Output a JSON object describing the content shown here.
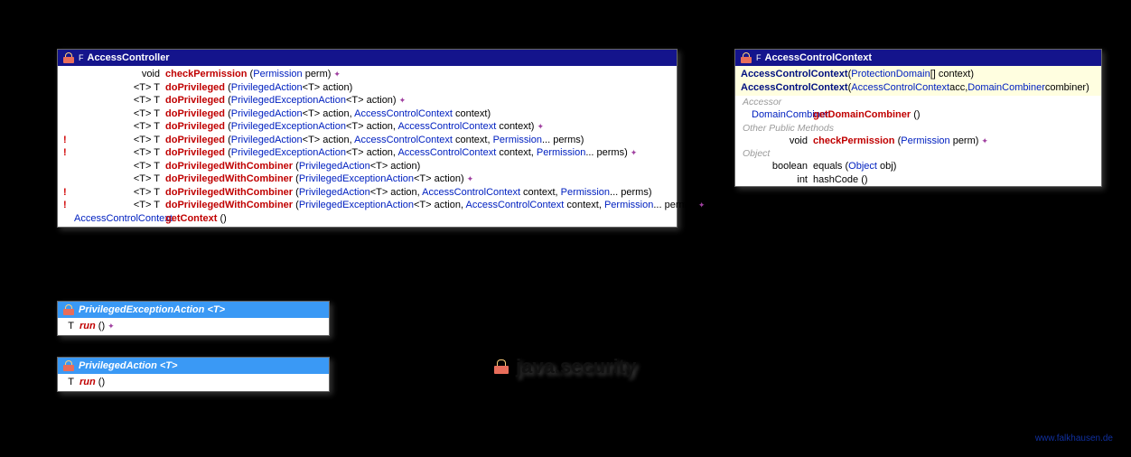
{
  "package": "java.security",
  "footer": "www.falkhausen.de",
  "classes": {
    "accessController": {
      "name": "AccessController",
      "modifier": "F",
      "methods": [
        {
          "alert": "",
          "ret": "void",
          "name": "checkPermission",
          "params_prefix": "(",
          "p1_type": "Permission",
          "p1_name": " perm)",
          "rest": "",
          "throws": true
        },
        {
          "alert": "",
          "ret": "<T> T",
          "name": "doPrivileged",
          "params_prefix": "(",
          "p1_type": "PrivilegedAction",
          "p1_name": "<T> action)",
          "rest": "",
          "throws": false
        },
        {
          "alert": "",
          "ret": "<T> T",
          "name": "doPrivileged",
          "params_prefix": "(",
          "p1_type": "PrivilegedExceptionAction",
          "p1_name": "<T> action)",
          "rest": "",
          "throws": true
        },
        {
          "alert": "",
          "ret": "<T> T",
          "name": "doPrivileged",
          "params_prefix": "(",
          "p1_type": "PrivilegedAction",
          "p1_name": "<T> action, ",
          "p2_type": "AccessControlContext",
          "p2_name": " context)",
          "throws": false
        },
        {
          "alert": "",
          "ret": "<T> T",
          "name": "doPrivileged",
          "params_prefix": "(",
          "p1_type": "PrivilegedExceptionAction",
          "p1_name": "<T> action, ",
          "p2_type": "AccessControlContext",
          "p2_name": " context)",
          "throws": true
        },
        {
          "alert": "!",
          "ret": "<T> T",
          "name": "doPrivileged",
          "params_prefix": "(",
          "p1_type": "PrivilegedAction",
          "p1_name": "<T> action, ",
          "p2_type": "AccessControlContext",
          "p2_name": " context, ",
          "p3_type": "Permission",
          "p3_name": "... perms)",
          "throws": false
        },
        {
          "alert": "!",
          "ret": "<T> T",
          "name": "doPrivileged",
          "params_prefix": "(",
          "p1_type": "PrivilegedExceptionAction",
          "p1_name": "<T> action, ",
          "p2_type": "AccessControlContext",
          "p2_name": " context, ",
          "p3_type": "Permission",
          "p3_name": "... perms)",
          "throws": true
        },
        {
          "alert": "",
          "ret": "<T> T",
          "name": "doPrivilegedWithCombiner",
          "params_prefix": "(",
          "p1_type": "PrivilegedAction",
          "p1_name": "<T> action)",
          "throws": false
        },
        {
          "alert": "",
          "ret": "<T> T",
          "name": "doPrivilegedWithCombiner",
          "params_prefix": "(",
          "p1_type": "PrivilegedExceptionAction",
          "p1_name": "<T> action)",
          "throws": true
        },
        {
          "alert": "!",
          "ret": "<T> T",
          "name": "doPrivilegedWithCombiner",
          "params_prefix": "(",
          "p1_type": "PrivilegedAction",
          "p1_name": "<T> action, ",
          "p2_type": "AccessControlContext",
          "p2_name": " context, ",
          "p3_type": "Permission",
          "p3_name": "... perms)",
          "throws": false
        },
        {
          "alert": "!",
          "ret": "<T> T",
          "name": "doPrivilegedWithCombiner",
          "params_prefix": "(",
          "p1_type": "PrivilegedExceptionAction",
          "p1_name": "<T> action, ",
          "p2_type": "AccessControlContext",
          "p2_name": " context, ",
          "p3_type": "Permission",
          "p3_name": "... perms)",
          "throws": true
        },
        {
          "alert": "",
          "ret_type": "AccessControlContext",
          "name": "getContext",
          "params_prefix": "()",
          "throws": false
        }
      ]
    },
    "accessControlContext": {
      "name": "AccessControlContext",
      "modifier": "F",
      "constructors": [
        {
          "name": "AccessControlContext",
          "params": "(",
          "p1_type": "ProtectionDomain",
          "p1_name": "[] context)"
        },
        {
          "name": "AccessControlContext",
          "params": "(",
          "p1_type": "AccessControlContext",
          "p1_name": " acc, ",
          "p2_type": "DomainCombiner",
          "p2_name": " combiner)"
        }
      ],
      "sections": {
        "accessor": "Accessor",
        "other": "Other Public Methods",
        "object": "Object"
      },
      "accessor_method": {
        "ret_type": "DomainCombiner",
        "name": "getDomainCombiner",
        "params": "()"
      },
      "other_method": {
        "ret": "void",
        "name": "checkPermission",
        "params": "(",
        "p1_type": "Permission",
        "p1_name": " perm)",
        "throws": true
      },
      "object_methods": [
        {
          "ret": "boolean",
          "name": "equals",
          "params": "(",
          "p1_type": "Object",
          "p1_name": " obj)"
        },
        {
          "ret": "int",
          "name": "hashCode",
          "params": "()"
        }
      ]
    },
    "privilegedExceptionAction": {
      "name": "PrivilegedExceptionAction",
      "generic": "<T>",
      "method": {
        "ret": "T",
        "name": "run",
        "params": "()",
        "throws": true
      }
    },
    "privilegedAction": {
      "name": "PrivilegedAction",
      "generic": "<T>",
      "method": {
        "ret": "T",
        "name": "run",
        "params": "()"
      }
    }
  }
}
